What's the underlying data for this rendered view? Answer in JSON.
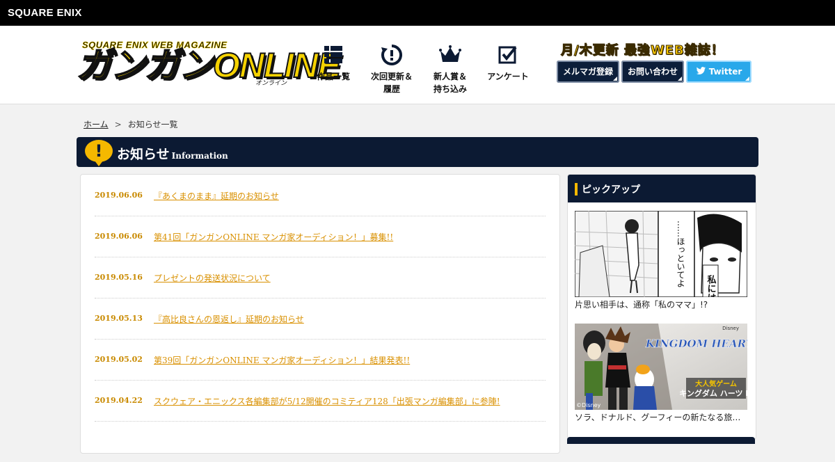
{
  "corp": "SQUARE ENIX",
  "logo": {
    "sub": "SQUARE ENIX WEB MAGAZINE",
    "main": "ガンガンONLINE",
    "kana": "オンライン"
  },
  "nav": [
    {
      "label": "作品一覧",
      "icon": "list-icon"
    },
    {
      "label": "次回更新＆履歴",
      "icon": "clock-refresh-icon"
    },
    {
      "label": "新人賞＆持ち込み",
      "icon": "crown-icon"
    },
    {
      "label": "アンケート",
      "icon": "checkbox-icon"
    }
  ],
  "tagline": "月/木更新 最強WEB雑誌！",
  "buttons": {
    "mailmag": "メルマガ登録",
    "contact": "お問い合わせ",
    "twitter": "Twitter"
  },
  "breadcrumb": {
    "home": "ホーム",
    "sep": ">",
    "current": "お知らせ一覧"
  },
  "page_title": {
    "icon": "!",
    "ja": "お知らせ",
    "en": "Information"
  },
  "news": [
    {
      "date": "2019.06.06",
      "title": "『あくまのまま』延期のお知らせ"
    },
    {
      "date": "2019.06.06",
      "title": "第41回「ガンガンONLINE マンガ家オーディション！」募集!!"
    },
    {
      "date": "2019.05.16",
      "title": "プレゼントの発送状況について"
    },
    {
      "date": "2019.05.13",
      "title": "『高比良さんの恩返し』延期のお知らせ"
    },
    {
      "date": "2019.05.02",
      "title": "第39回「ガンガンONLINE マンガ家オーディション！」結果発表!!"
    },
    {
      "date": "2019.04.22",
      "title": "スクウェア・エニックス各編集部が5/12開催のコミティア128「出張マンガ編集部」に参陣!"
    }
  ],
  "pickup": {
    "title": "ピックアップ",
    "items": [
      {
        "caption": "片思い相手は、通称「私のママ」!?",
        "img_text_1": "……ほっといてよ",
        "img_text_2": "私には"
      },
      {
        "caption": "ソラ、ドナルド、グーフィーの新たなる旅…",
        "img_text_1": "KINGDOM HEARTS III",
        "img_text_2": "大人気ゲーム",
        "img_text_3": "キングダム ハーツ Ⅲ",
        "img_text_4": "©Disney",
        "img_text_5": "Disney"
      }
    ]
  },
  "colors": {
    "navy": "#0c1a33",
    "accent": "#f5b800",
    "link": "#d99000",
    "twitter": "#29a8ea"
  }
}
